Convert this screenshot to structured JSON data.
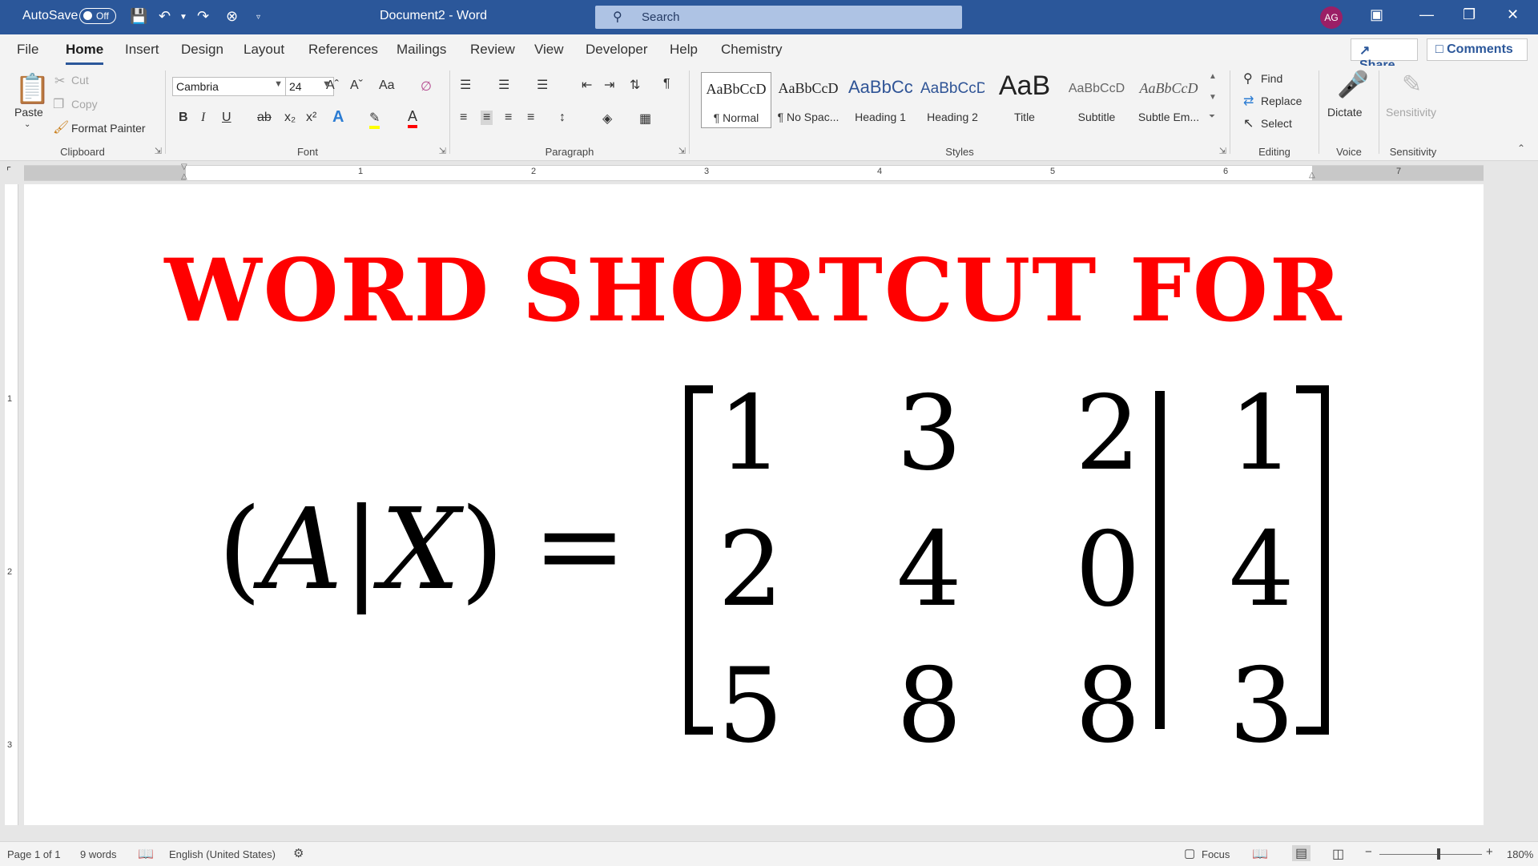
{
  "title_bar": {
    "autosave_label": "AutoSave",
    "autosave_state": "Off",
    "document_title": "Document2  -  Word",
    "search_placeholder": "Search",
    "user_initials": "AG"
  },
  "tabs": [
    "File",
    "Home",
    "Insert",
    "Design",
    "Layout",
    "References",
    "Mailings",
    "Review",
    "View",
    "Developer",
    "Help",
    "Chemistry"
  ],
  "active_tab": "Home",
  "share_label": "Share",
  "comments_label": "Comments",
  "clipboard": {
    "paste": "Paste",
    "cut": "Cut",
    "copy": "Copy",
    "format_painter": "Format Painter",
    "label": "Clipboard"
  },
  "font": {
    "name": "Cambria",
    "size": "24",
    "label": "Font",
    "grow": "Aˆ",
    "shrink": "Aˇ",
    "case": "Aa"
  },
  "paragraph": {
    "label": "Paragraph"
  },
  "styles": {
    "label": "Styles",
    "items": [
      {
        "preview": "AaBbCcD",
        "name": "¶ Normal"
      },
      {
        "preview": "AaBbCcD",
        "name": "¶ No Spac..."
      },
      {
        "preview": "AaBbCc",
        "name": "Heading 1"
      },
      {
        "preview": "AaBbCcD",
        "name": "Heading 2"
      },
      {
        "preview": "AaB",
        "name": "Title"
      },
      {
        "preview": "AaBbCcD",
        "name": "Subtitle"
      },
      {
        "preview": "AaBbCcD",
        "name": "Subtle Em..."
      }
    ]
  },
  "editing": {
    "find": "Find",
    "replace": "Replace",
    "select": "Select",
    "label": "Editing"
  },
  "voice": {
    "dictate": "Dictate",
    "label": "Voice"
  },
  "sensitivity": {
    "button": "Sensitivity",
    "label": "Sensitivity"
  },
  "ruler_numbers": [
    "1",
    "2",
    "3",
    "4",
    "5",
    "6",
    "7"
  ],
  "vruler_numbers": [
    "1",
    "2",
    "3"
  ],
  "document": {
    "heading": "WORD SHORTCUT FOR",
    "equation": {
      "open_paren": "(",
      "var_a": "A",
      "bar": "|",
      "var_x": "X",
      "close_paren": ")",
      "equals": "=",
      "matrix": [
        [
          "1",
          "3",
          "2"
        ],
        [
          "2",
          "4",
          "0"
        ],
        [
          "5",
          "8",
          "8"
        ]
      ],
      "augmented": [
        "1",
        "4",
        "3"
      ]
    }
  },
  "status_bar": {
    "page": "Page 1 of 1",
    "words": "9 words",
    "language": "English (United States)",
    "focus": "Focus",
    "zoom": "180%"
  },
  "colors": {
    "title_bar": "#2b579a",
    "heading": "#ff0000",
    "avatar": "#9b1f66"
  }
}
